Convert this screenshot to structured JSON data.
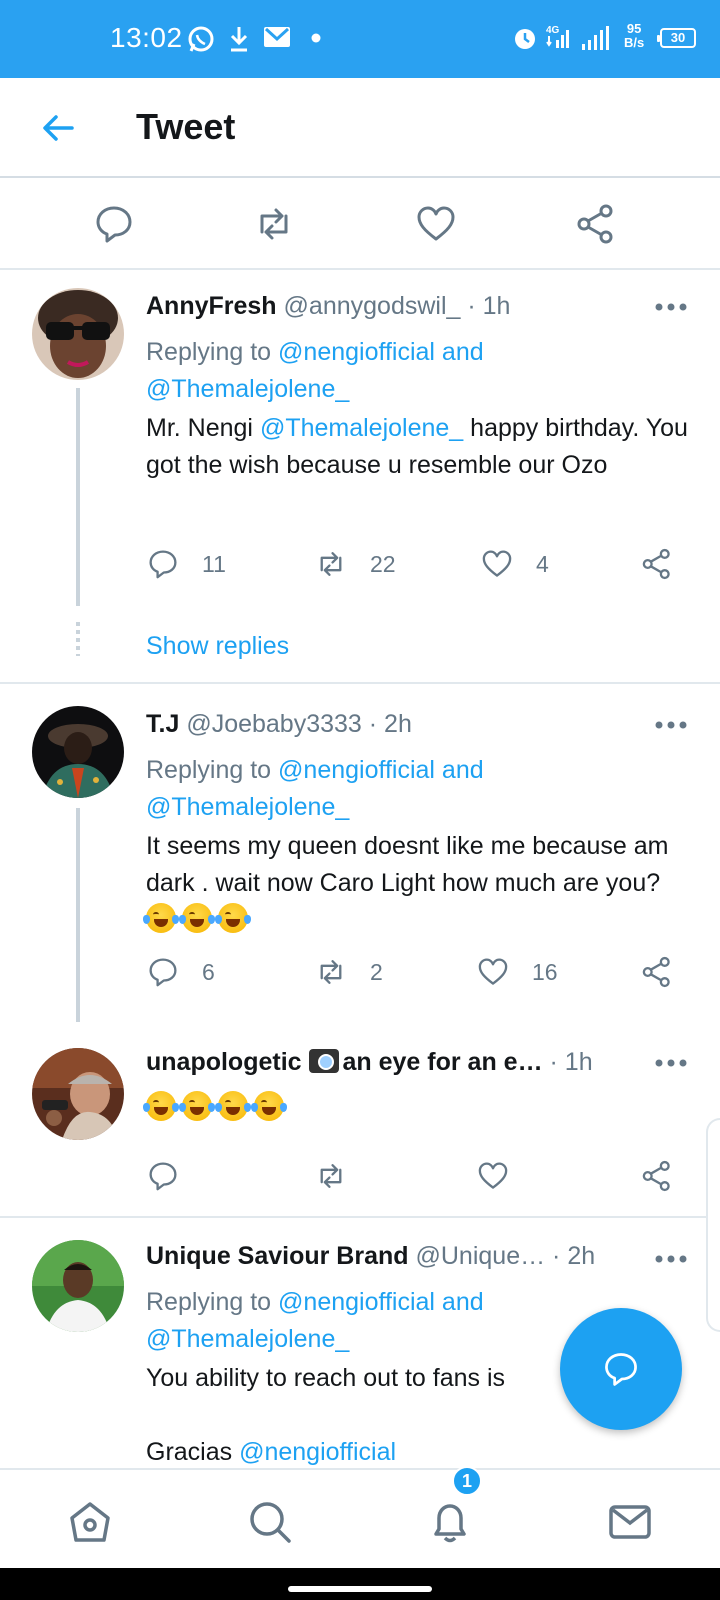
{
  "status_bar": {
    "time": "13:02",
    "network_speed_value": "95",
    "network_speed_unit": "B/s",
    "signal_label": "4G",
    "battery": "30",
    "icons": [
      "whatsapp-icon",
      "download-icon",
      "gmail-icon",
      "dot-icon",
      "alarm-icon",
      "signal-icon",
      "wifi-signal-icon",
      "battery-icon"
    ]
  },
  "header": {
    "title": "Tweet"
  },
  "tweets": [
    {
      "name": "AnnyFresh",
      "handle": "@annygodswil_",
      "time": "1h",
      "replying_prefix": "Replying to ",
      "replying_to": "@nengiofficial and @Themalejolene_",
      "text_before": "Mr. Nengi ",
      "mention": "@Themalejolene_",
      "text_after": " happy birthday. You got the wish because u resemble our Ozo",
      "replies": "11",
      "retweets": "22",
      "likes": "4",
      "show_replies": "Show replies"
    },
    {
      "name": "T.J",
      "handle": "@Joebaby3333",
      "time": "2h",
      "replying_prefix": "Replying to ",
      "replying_to": "@nengiofficial and @Themalejolene_",
      "text": "It seems my queen doesnt like me because am dark . wait now Caro Light how much are you?",
      "replies": "6",
      "retweets": "2",
      "likes": "16"
    },
    {
      "name_start": "unapologetic ",
      "name_end": "an eye for an e…",
      "time": "1h"
    },
    {
      "name": "Unique Saviour Brand",
      "handle": "@Unique…",
      "time": "2h",
      "replying_prefix": "Replying to ",
      "replying_to": "@nengiofficial and @Themalejolene_",
      "text": "You ability to reach out to fans is",
      "text2": "Gracias ",
      "mention": "@nengiofficial"
    }
  ],
  "bottom_nav": {
    "notification_count": "1"
  },
  "colors": {
    "brand": "#1da1f2",
    "status_bar": "#2aa1f1",
    "text": "#14171a",
    "muted": "#657786"
  }
}
